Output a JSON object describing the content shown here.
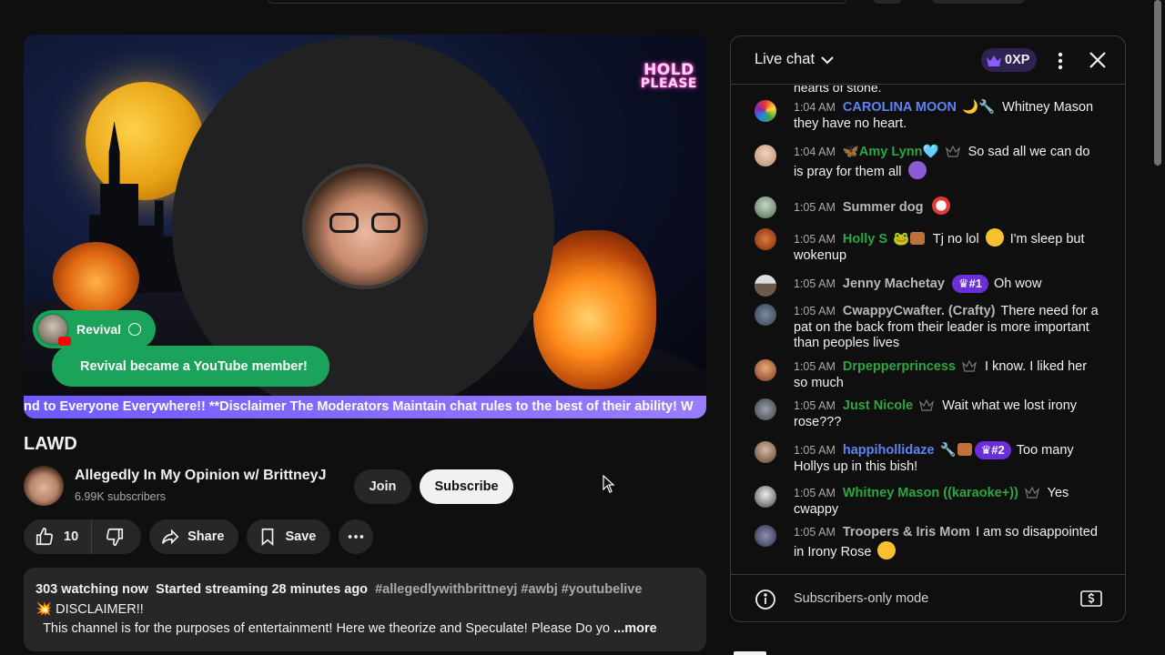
{
  "player": {
    "hold_line1": "HOLD",
    "hold_line2": "PLEASE",
    "member_chip_name": "Revival",
    "member_banner": "Revival became a YouTube member!",
    "ticker": "nd to Everyone Everywhere!! **Disclaimer The Moderators Maintain chat rules to the best of their ability! W"
  },
  "video": {
    "title": "LAWD",
    "channel_name": "Allegedly In My Opinion w/ BrittneyJ",
    "subscribers": "6.99K subscribers",
    "join_label": "Join",
    "subscribe_label": "Subscribe",
    "like_count": "10",
    "share_label": "Share",
    "save_label": "Save"
  },
  "description": {
    "watching": "303 watching now",
    "started": "Started streaming 28 minutes ago",
    "tags": "#allegedlywithbrittneyj #awbj #youtubelive",
    "disclaimer": "DISCLAIMER!!",
    "line3": "This channel is for the purposes of entertainment!  Here we theorize and Speculate!  Please Do yo",
    "more": "...more"
  },
  "chat": {
    "title": "Live chat",
    "xp": "0XP",
    "previous_fragment": "hearts of stone.",
    "footer_mode": "Subscribers-only mode",
    "messages": [
      {
        "time": "1:04 AM",
        "author": "CAROLINA MOON",
        "text": "Whitney Mason they have no heart."
      },
      {
        "time": "1:04 AM",
        "author": "🦋Amy Lynn🩵",
        "text": "So sad all we can do is pray for them all"
      },
      {
        "time": "1:05 AM",
        "author": "Summer dog",
        "text": ""
      },
      {
        "time": "1:05 AM",
        "author": "Holly S",
        "text_a": "Tj no lol",
        "text_b": "I'm sleep but wokenup"
      },
      {
        "time": "1:05 AM",
        "author": "Jenny Machetay",
        "rank": "#1",
        "text": "Oh wow"
      },
      {
        "time": "1:05 AM",
        "author": "CwappyCwafter. (Crafty)",
        "text": "There need for a pat on the back from their leader is more important than peoples lives"
      },
      {
        "time": "1:05 AM",
        "author": "Drpepperprincess",
        "text": "I know. I liked her so much"
      },
      {
        "time": "1:05 AM",
        "author": "Just Nicole",
        "text": "Wait what we lost irony rose???"
      },
      {
        "time": "1:05 AM",
        "author": "happihollidaze",
        "rank": "#2",
        "text": "Too many Hollys up in this bish!"
      },
      {
        "time": "1:05 AM",
        "author": "Whitney Mason ((karaoke+))",
        "text": "Yes cwappy"
      },
      {
        "time": "1:05 AM",
        "author": "Troopers & Iris Mom",
        "text": "I am so disappointed in Irony Rose"
      }
    ]
  },
  "colors": {
    "background": "#0f0f0f",
    "member_green": "#1ba35b",
    "ticker_purple": "#7c66ff",
    "rank_purple": "#6a2fd8",
    "author_blue": "#5e84f1",
    "author_green": "#2ba640"
  }
}
